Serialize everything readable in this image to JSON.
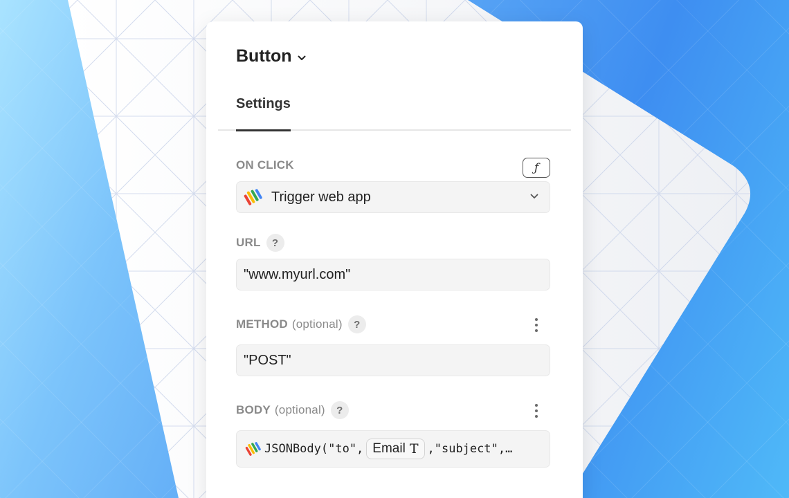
{
  "panel": {
    "title": "Button",
    "tabs": [
      {
        "label": "Settings",
        "active": true
      }
    ]
  },
  "on_click": {
    "label": "ON CLICK",
    "fx_label": "ƒ",
    "value": "Trigger web app",
    "icon": "google-apps-script-icon"
  },
  "url": {
    "label": "URL",
    "help": "?",
    "value": "\"www.myurl.com\""
  },
  "method": {
    "label": "METHOD",
    "optional": "(optional)",
    "help": "?",
    "value": "\"POST\""
  },
  "body": {
    "label": "BODY",
    "optional": "(optional)",
    "help": "?",
    "prefix": "JSONBody(\"to\",",
    "chip_label": "Email",
    "chip_type": "T",
    "suffix": ",\"subject\",…"
  },
  "colors": {
    "background_blue": "#3e8ef1",
    "panel_bg": "#ffffff",
    "input_bg": "#f4f4f4"
  }
}
